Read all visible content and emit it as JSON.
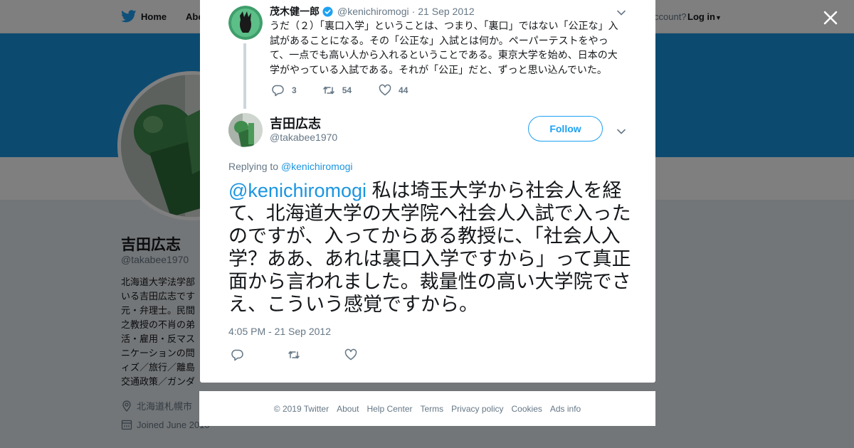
{
  "background": {
    "nav": {
      "home": "Home",
      "about": "Abo",
      "account_prompt": "ccount?",
      "login": "Log in"
    },
    "profile": {
      "name": "吉田広志",
      "handle": "@takabee1970",
      "bio": "北海道大学法学部\nいる吉田広志です\n元・弁理士。民間\n之教授の不肖の弟\n活・雇用・反マス\nニケーションの問\nィズ／旅行／離島\n交通政策／ガンダム／将棋…",
      "location": "北海道札幌市",
      "joined": "Joined June 2010"
    }
  },
  "parent_tweet": {
    "name": "茂木健一郎",
    "handle": "@kenichiromogi",
    "date": "21 Sep 2012",
    "text": "うだ（２）「裏口入学」ということは、つまり、「裏口」ではない「公正な」入試があることになる。その「公正な」入試とは何か。ペーパーテストをやって、一点でも高い人から入れるということである。東京大学を始め、日本の大学がやっている入試である。それが「公正」だと、ずっと思い込んでいた。",
    "replies": "3",
    "retweets": "54",
    "likes": "44"
  },
  "main_tweet": {
    "name": "吉田広志",
    "handle": "@takabee1970",
    "follow_label": "Follow",
    "replying_prefix": "Replying to ",
    "replying_to": "@kenichiromogi",
    "mention": "@kenichiromogi",
    "text": " 私は埼玉大学から社会人を経て、北海道大学の大学院へ社会人入試で入ったのですが、入ってからある教授に、「社会人入学？ああ、あれは裏口入学ですから」って真正面から言われました。裁量性の高い大学院でさえ、こういう感覚ですから。",
    "timestamp": "4:05 PM - 21 Sep 2012"
  },
  "footer": {
    "copyright": "© 2019 Twitter",
    "about": "About",
    "help": "Help Center",
    "terms": "Terms",
    "privacy": "Privacy policy",
    "cookies": "Cookies",
    "ads": "Ads info"
  },
  "colors": {
    "twitter_blue": "#1da1f2",
    "link_blue": "#1b95e0",
    "banner": "#1b95e0",
    "secondary_text": "#657786"
  },
  "icons": [
    "twitter-bird-icon",
    "close-icon",
    "verified-badge-icon",
    "chevron-down-icon",
    "reply-icon",
    "retweet-icon",
    "like-icon",
    "location-pin-icon",
    "calendar-icon"
  ]
}
